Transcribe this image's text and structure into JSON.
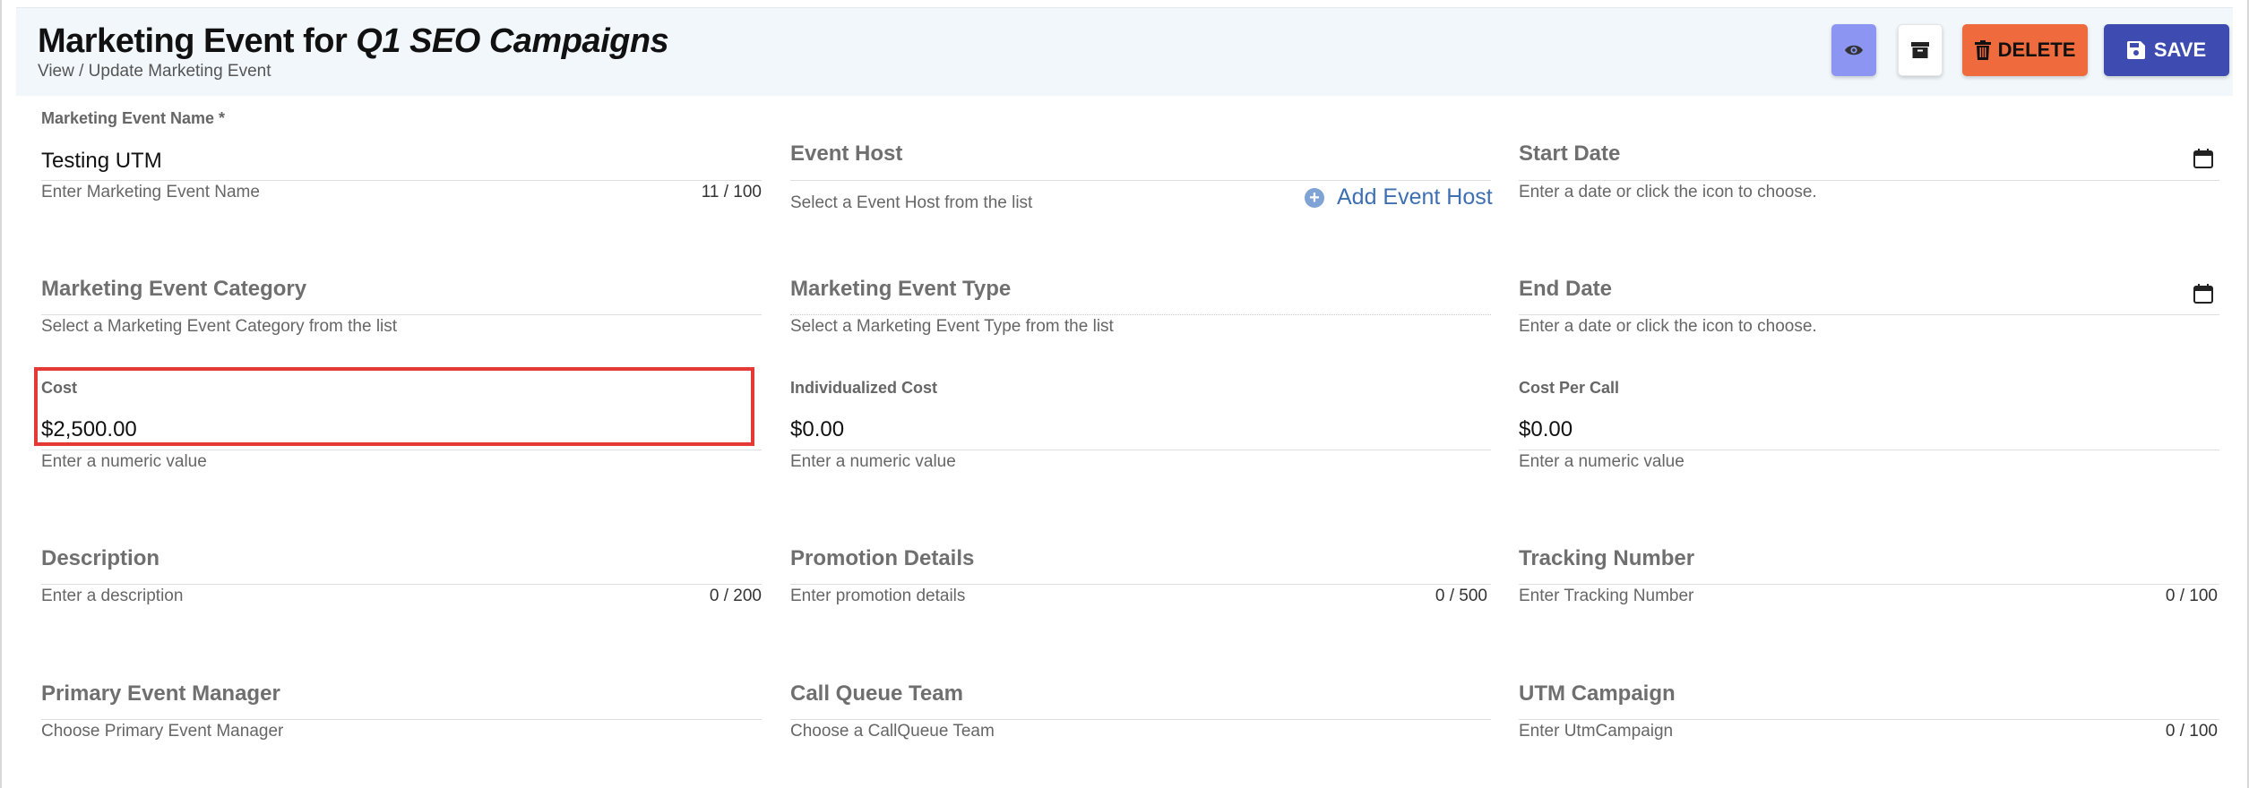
{
  "header": {
    "title_prefix": "Marketing Event for",
    "title_name": "Q1 SEO Campaigns",
    "subtitle": "View / Update Marketing Event"
  },
  "toolbar": {
    "view_icon": "eye-icon",
    "archive_icon": "archive-icon",
    "delete_label": "DELETE",
    "save_label": "SAVE",
    "colors": {
      "view": "#8c95f2",
      "delete": "#ef6a3c",
      "save": "#3e4bb0"
    }
  },
  "fields": {
    "event_name": {
      "label": "Marketing Event Name *",
      "value": "Testing UTM",
      "hint": "Enter Marketing Event Name",
      "counter": "11 / 100"
    },
    "event_host": {
      "label": "Event Host",
      "hint": "Select a Event Host from the list",
      "add_label": "Add Event Host"
    },
    "start_date": {
      "label": "Start Date",
      "hint": "Enter a date or click the icon to choose."
    },
    "event_category": {
      "label": "Marketing Event Category",
      "hint": "Select a Marketing Event Category from the list"
    },
    "event_type": {
      "label": "Marketing Event Type",
      "hint": "Select a Marketing Event Type from the list"
    },
    "end_date": {
      "label": "End Date",
      "hint": "Enter a date or click the icon to choose."
    },
    "cost": {
      "label": "Cost",
      "value": "$2,500.00",
      "hint": "Enter a numeric value"
    },
    "individualized_cost": {
      "label": "Individualized Cost",
      "value": "$0.00",
      "hint": "Enter a numeric value"
    },
    "cost_per_call": {
      "label": "Cost Per Call",
      "value": "$0.00",
      "hint": "Enter a numeric value"
    },
    "description": {
      "label": "Description",
      "hint": "Enter a description",
      "counter": "0 / 200"
    },
    "promotion_details": {
      "label": "Promotion Details",
      "hint": "Enter promotion details",
      "counter": "0 / 500"
    },
    "tracking_number": {
      "label": "Tracking Number",
      "hint": "Enter Tracking Number",
      "counter": "0 / 100"
    },
    "primary_manager": {
      "label": "Primary Event Manager",
      "hint": "Choose Primary Event Manager"
    },
    "call_queue_team": {
      "label": "Call Queue Team",
      "hint": "Choose a CallQueue Team"
    },
    "utm_campaign": {
      "label": "UTM Campaign",
      "hint": "Enter UtmCampaign",
      "counter": "0 / 100"
    }
  }
}
